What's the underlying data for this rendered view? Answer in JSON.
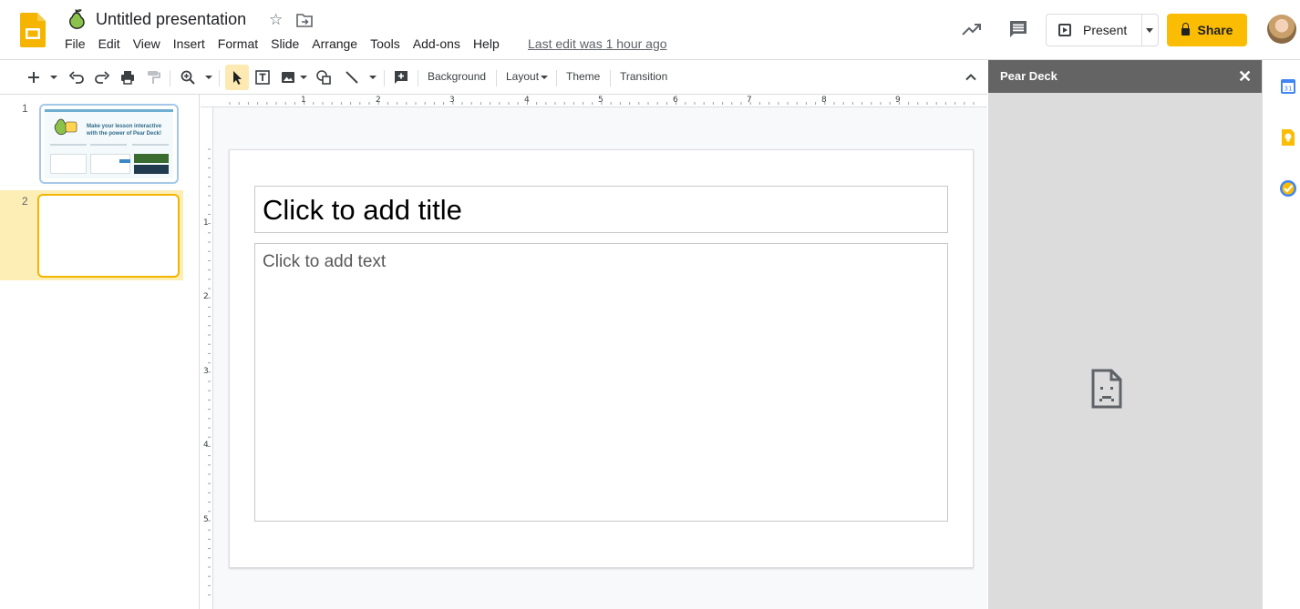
{
  "header": {
    "doc_title": "Untitled presentation",
    "menu": [
      "File",
      "Edit",
      "View",
      "Insert",
      "Format",
      "Slide",
      "Arrange",
      "Tools",
      "Add-ons",
      "Help"
    ],
    "last_edit": "Last edit was 1 hour ago",
    "present_label": "Present",
    "share_label": "Share"
  },
  "toolbar": {
    "background_label": "Background",
    "layout_label": "Layout",
    "theme_label": "Theme",
    "transition_label": "Transition"
  },
  "filmstrip": {
    "slides": [
      {
        "number": "1",
        "thumb_text": "Make your lesson interactive with the power of Pear Deck!"
      },
      {
        "number": "2"
      }
    ]
  },
  "ruler": {
    "horizontal": [
      "1",
      "2",
      "3",
      "4",
      "5",
      "6",
      "7",
      "8",
      "9"
    ],
    "vertical": [
      "1",
      "2",
      "3",
      "4",
      "5"
    ]
  },
  "slide": {
    "title_placeholder": "Click to add title",
    "body_placeholder": "Click to add text"
  },
  "panel": {
    "title": "Pear Deck",
    "close_glyph": "✕"
  },
  "colors": {
    "share": "#fbbc04",
    "panel_header": "#646464",
    "panel_bg": "#dcdcdc",
    "selected_slide": "#f4b400"
  }
}
